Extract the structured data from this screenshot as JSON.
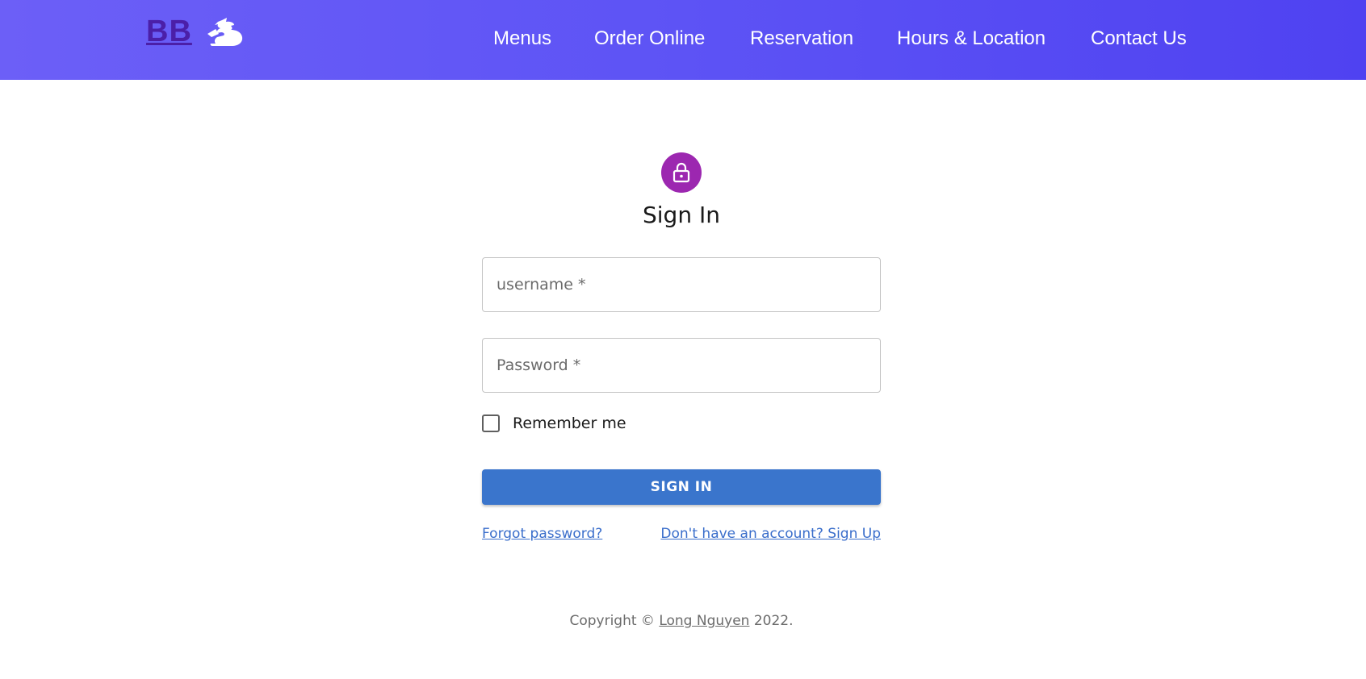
{
  "header": {
    "brand": "BB",
    "logo_icon": "dragon-icon",
    "nav": {
      "menus": "Menus",
      "order_online": "Order Online",
      "reservation": "Reservation",
      "hours_location": "Hours & Location",
      "contact_us": "Contact Us"
    }
  },
  "form": {
    "icon": "lock-icon",
    "title": "Sign In",
    "username_placeholder": "username *",
    "password_placeholder": "Password *",
    "remember_label": "Remember me",
    "remember_checked": false,
    "submit_label": "SIGN IN",
    "forgot_link": "Forgot password?",
    "signup_link": "Don't have an account? Sign Up"
  },
  "footer": {
    "copyright_prefix": "Copyright © ",
    "author": "Long Nguyen",
    "year_suffix": " 2022."
  },
  "colors": {
    "header_gradient_start": "#6c5ff7",
    "header_gradient_end": "#4f42f1",
    "brand_text": "#4b1fa8",
    "avatar": "#9c27b0",
    "primary_button": "#3a75cc",
    "link": "#3a6ecb"
  }
}
